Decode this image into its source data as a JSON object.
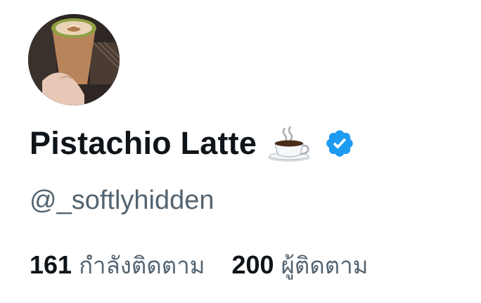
{
  "profile": {
    "display_name": "Pistachio Latte",
    "name_emoji": "☕",
    "username": "@_softlyhidden",
    "verified_color": "#1d9bf0"
  },
  "stats": {
    "following_count": "161",
    "following_label": "กำลังติดตาม",
    "followers_count": "200",
    "followers_label": "ผู้ติดตาม"
  },
  "icons": {
    "avatar": "avatar-photo-latte-cup",
    "emoji": "coffee-cup-icon",
    "badge": "verified-badge-icon"
  }
}
